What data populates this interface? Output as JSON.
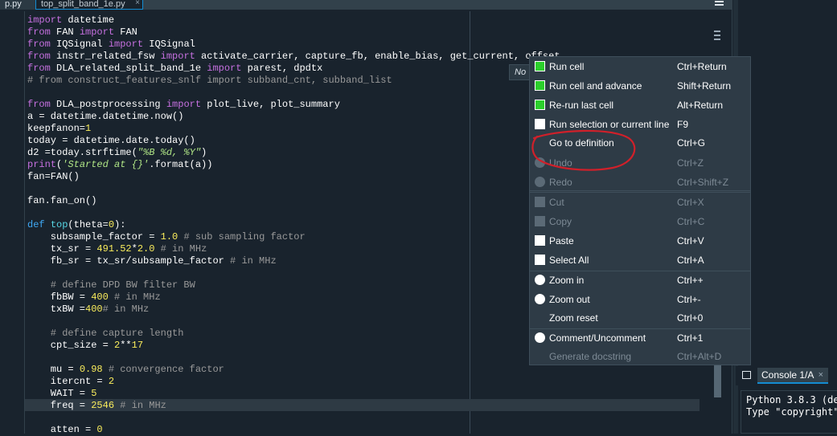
{
  "tabs": [
    {
      "label": "p.py"
    },
    {
      "label": "top_split_band_1e.py",
      "close": "×"
    }
  ],
  "code": {
    "lines": [
      [
        {
          "t": "import",
          "c": "kw"
        },
        {
          "t": " datetime",
          "c": "mod"
        }
      ],
      [
        {
          "t": "from",
          "c": "kw"
        },
        {
          "t": " FAN ",
          "c": "mod"
        },
        {
          "t": "import",
          "c": "kw"
        },
        {
          "t": " FAN",
          "c": "mod"
        }
      ],
      [
        {
          "t": "from",
          "c": "kw"
        },
        {
          "t": " IQSignal ",
          "c": "mod"
        },
        {
          "t": "import",
          "c": "kw"
        },
        {
          "t": " IQSignal",
          "c": "mod"
        }
      ],
      [
        {
          "t": "from",
          "c": "kw"
        },
        {
          "t": " instr_related_fsw ",
          "c": "mod"
        },
        {
          "t": "import",
          "c": "kw"
        },
        {
          "t": " activate_carrier, capture_fb, enable_bias, get_current, offset",
          "c": "mod"
        }
      ],
      [
        {
          "t": "from",
          "c": "kw"
        },
        {
          "t": " DLA_related_split_band_1e ",
          "c": "mod"
        },
        {
          "t": "import",
          "c": "kw"
        },
        {
          "t": " parest, dpdtx",
          "c": "mod"
        }
      ],
      [
        {
          "t": "# from construct_features_snlf import subband_cnt, subband_list",
          "c": "cm"
        }
      ],
      [],
      [
        {
          "t": "from",
          "c": "kw"
        },
        {
          "t": " DLA_postprocessing ",
          "c": "mod"
        },
        {
          "t": "import",
          "c": "kw"
        },
        {
          "t": " plot_live, plot_summary",
          "c": "mod"
        }
      ],
      [
        {
          "t": "a = datetime.datetime.now()",
          "c": "op"
        }
      ],
      [
        {
          "t": "keepfanon=",
          "c": "op"
        },
        {
          "t": "1",
          "c": "num"
        }
      ],
      [
        {
          "t": "today = datetime.date.today()",
          "c": "op"
        }
      ],
      [
        {
          "t": "d2 =today.strftime(",
          "c": "op"
        },
        {
          "t": "\"%B %d, %Y\"",
          "c": "str"
        },
        {
          "t": ")",
          "c": "op"
        }
      ],
      [
        {
          "t": "print",
          "c": "kw"
        },
        {
          "t": "(",
          "c": "op"
        },
        {
          "t": "'Started at {}'",
          "c": "str"
        },
        {
          "t": ".format(a))",
          "c": "op"
        }
      ],
      [
        {
          "t": "fan=FAN()",
          "c": "op"
        }
      ],
      [],
      [
        {
          "t": "fan.fan_on()",
          "c": "op"
        }
      ],
      [],
      [
        {
          "t": "def",
          "c": "kb"
        },
        {
          "t": " ",
          "c": "op"
        },
        {
          "t": "top",
          "c": "fn"
        },
        {
          "t": "(theta=",
          "c": "op"
        },
        {
          "t": "0",
          "c": "num"
        },
        {
          "t": "):",
          "c": "op"
        }
      ],
      [
        {
          "t": "    subsample_factor = ",
          "c": "op"
        },
        {
          "t": "1.0",
          "c": "num"
        },
        {
          "t": " # sub sampling factor",
          "c": "cm"
        }
      ],
      [
        {
          "t": "    tx_sr = ",
          "c": "op"
        },
        {
          "t": "491.52",
          "c": "num"
        },
        {
          "t": "*",
          "c": "op"
        },
        {
          "t": "2.0",
          "c": "num"
        },
        {
          "t": " # in MHz",
          "c": "cm"
        }
      ],
      [
        {
          "t": "    fb_sr = tx_sr/subsample_factor",
          "c": "op"
        },
        {
          "t": " # in MHz",
          "c": "cm"
        }
      ],
      [],
      [
        {
          "t": "    # define DPD BW filter BW",
          "c": "cm"
        }
      ],
      [
        {
          "t": "    fbBW = ",
          "c": "op"
        },
        {
          "t": "400",
          "c": "num"
        },
        {
          "t": " # in MHz",
          "c": "cm"
        }
      ],
      [
        {
          "t": "    txBW =",
          "c": "op"
        },
        {
          "t": "400",
          "c": "num"
        },
        {
          "t": "# in MHz",
          "c": "cm"
        }
      ],
      [],
      [
        {
          "t": "    # define capture length",
          "c": "cm"
        }
      ],
      [
        {
          "t": "    cpt_size = ",
          "c": "op"
        },
        {
          "t": "2",
          "c": "num"
        },
        {
          "t": "**",
          "c": "op"
        },
        {
          "t": "17",
          "c": "num"
        }
      ],
      [],
      [
        {
          "t": "    mu = ",
          "c": "op"
        },
        {
          "t": "0.98",
          "c": "num"
        },
        {
          "t": " # convergence factor",
          "c": "cm"
        }
      ],
      [
        {
          "t": "    itercnt = ",
          "c": "op"
        },
        {
          "t": "2",
          "c": "num"
        }
      ],
      [
        {
          "t": "    WAIT = ",
          "c": "op"
        },
        {
          "t": "5",
          "c": "num"
        }
      ],
      [
        {
          "t": "    freq = ",
          "c": "op"
        },
        {
          "t": "2546",
          "c": "num"
        },
        {
          "t": " # in MHz",
          "c": "cm"
        }
      ],
      [],
      [
        {
          "t": "    atten = ",
          "c": "op"
        },
        {
          "t": "0",
          "c": "num"
        }
      ]
    ]
  },
  "tooltip": {
    "text": "No"
  },
  "context_menu": {
    "items": [
      {
        "label": "Run cell",
        "shortcut": "Ctrl+Return",
        "icon": "run-cell-icon",
        "enabled": true
      },
      {
        "label": "Run cell and advance",
        "shortcut": "Shift+Return",
        "icon": "run-cell-advance-icon",
        "enabled": true
      },
      {
        "label": "Re-run last cell",
        "shortcut": "Alt+Return",
        "icon": "rerun-cell-icon",
        "enabled": true
      },
      {
        "label": "Run selection or current line",
        "shortcut": "F9",
        "icon": "run-selection-icon",
        "enabled": true
      },
      {
        "label": "Go to definition",
        "shortcut": "Ctrl+G",
        "icon": "",
        "enabled": true
      },
      {
        "label": "Undo",
        "shortcut": "Ctrl+Z",
        "icon": "undo-icon",
        "enabled": false
      },
      {
        "label": "Redo",
        "shortcut": "Ctrl+Shift+Z",
        "icon": "redo-icon",
        "enabled": false
      },
      {
        "label": "Cut",
        "shortcut": "Ctrl+X",
        "icon": "cut-icon",
        "enabled": false
      },
      {
        "label": "Copy",
        "shortcut": "Ctrl+C",
        "icon": "copy-icon",
        "enabled": false
      },
      {
        "label": "Paste",
        "shortcut": "Ctrl+V",
        "icon": "paste-icon",
        "enabled": true
      },
      {
        "label": "Select All",
        "shortcut": "Ctrl+A",
        "icon": "select-all-icon",
        "enabled": true
      },
      {
        "label": "Zoom in",
        "shortcut": "Ctrl++",
        "icon": "zoom-in-icon",
        "enabled": true
      },
      {
        "label": "Zoom out",
        "shortcut": "Ctrl+-",
        "icon": "zoom-out-icon",
        "enabled": true
      },
      {
        "label": "Zoom reset",
        "shortcut": "Ctrl+0",
        "icon": "",
        "enabled": true
      },
      {
        "label": "Comment/Uncomment",
        "shortcut": "Ctrl+1",
        "icon": "comment-icon",
        "enabled": true
      },
      {
        "label": "Generate docstring",
        "shortcut": "Ctrl+Alt+D",
        "icon": "",
        "enabled": false
      }
    ]
  },
  "console": {
    "tab_label": "Console 1/A",
    "tab_close": "×",
    "lines": [
      "Python 3.8.3 (de",
      "Type \"copyright\""
    ]
  },
  "colors": {
    "background": "#19232d",
    "menu_background": "#2e3b46",
    "accent": "#148cd2",
    "annotation": "#d0202a"
  }
}
